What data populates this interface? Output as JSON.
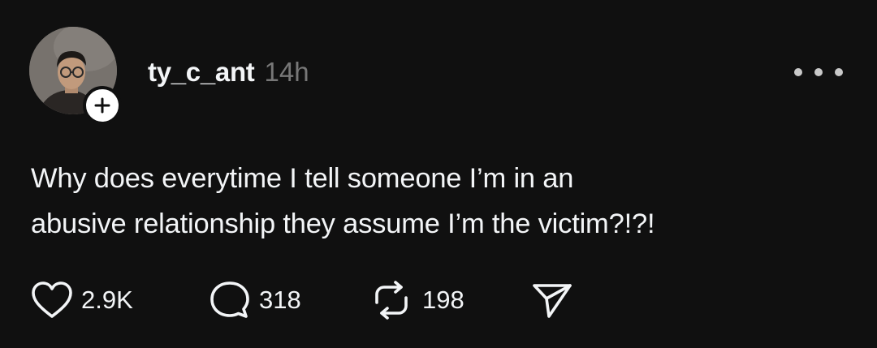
{
  "post": {
    "username": "ty_c_ant",
    "timestamp": "14h",
    "text_lines": [
      "Why does everytime I tell someone I’m in an",
      "abusive relationship they assume I’m the victim?!?!"
    ],
    "likes": "2.9K",
    "replies": "318",
    "reposts": "198"
  },
  "icons": {
    "like": "heart-icon",
    "reply": "comment-bubble-icon",
    "repost": "repost-arrows-icon",
    "share": "send-icon",
    "more": "more-dots-icon",
    "follow": "plus-icon"
  },
  "colors": {
    "background": "#101010",
    "text": "#f3f5f7",
    "muted": "#777777"
  }
}
